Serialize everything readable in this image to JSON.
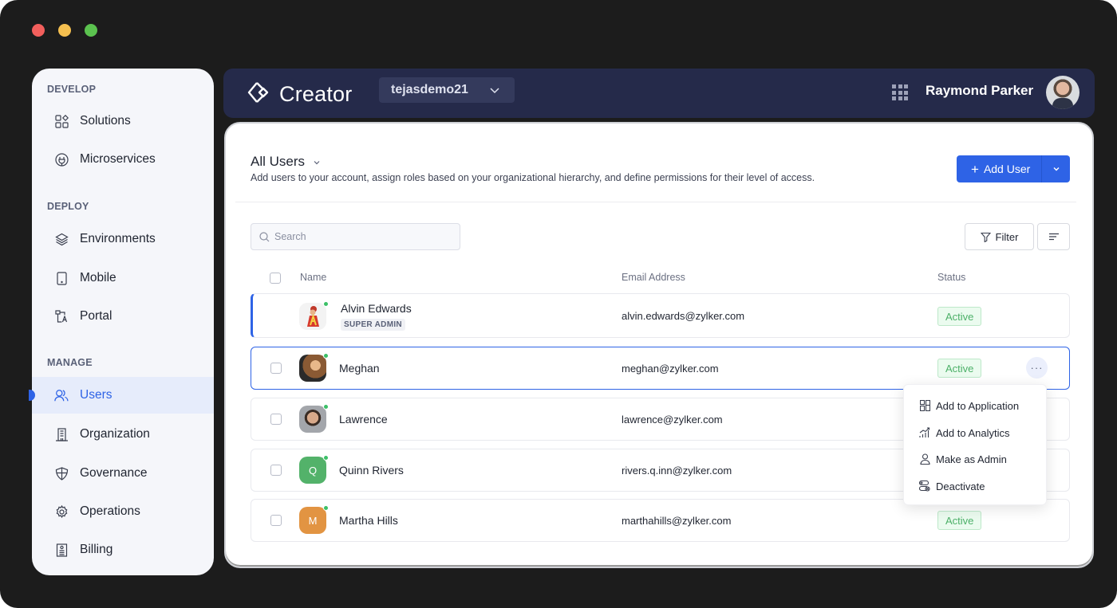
{
  "window": {
    "controls": [
      "close",
      "minimize",
      "maximize"
    ]
  },
  "sidebar": {
    "sections": [
      {
        "title": "DEVELOP",
        "items": [
          {
            "label": "Solutions",
            "icon": "solutions-icon"
          },
          {
            "label": "Microservices",
            "icon": "plug-icon"
          }
        ]
      },
      {
        "title": "DEPLOY",
        "items": [
          {
            "label": "Environments",
            "icon": "layers-icon"
          },
          {
            "label": "Mobile",
            "icon": "mobile-icon"
          },
          {
            "label": "Portal",
            "icon": "portal-icon"
          }
        ]
      },
      {
        "title": "MANAGE",
        "items": [
          {
            "label": "Users",
            "icon": "users-icon",
            "active": true
          },
          {
            "label": "Organization",
            "icon": "building-icon"
          },
          {
            "label": "Governance",
            "icon": "shield-icon"
          },
          {
            "label": "Operations",
            "icon": "gear-icon"
          },
          {
            "label": "Billing",
            "icon": "receipt-icon"
          }
        ]
      }
    ]
  },
  "header": {
    "app_name": "Creator",
    "workspace": "tejasdemo21",
    "user_name": "Raymond Parker",
    "accent": "#252a4a"
  },
  "main": {
    "title": "All Users",
    "description": "Add users to your account, assign roles based on your organizational hierarchy, and define permissions for their level of access.",
    "add_user_label": "Add User",
    "search_placeholder": "Search",
    "filter_label": "Filter",
    "columns": {
      "name": "Name",
      "email": "Email Address",
      "status": "Status"
    },
    "users": [
      {
        "name": "Alvin Edwards",
        "role": "SUPER ADMIN",
        "email": "alvin.edwards@zylker.com",
        "status": "Active",
        "initial": ""
      },
      {
        "name": "Meghan",
        "role": "",
        "email": "meghan@zylker.com",
        "status": "Active",
        "initial": ""
      },
      {
        "name": "Lawrence",
        "role": "",
        "email": "lawrence@zylker.com",
        "status": "",
        "initial": ""
      },
      {
        "name": "Quinn Rivers",
        "role": "",
        "email": "rivers.q.inn@zylker.com",
        "status": "",
        "initial": "Q"
      },
      {
        "name": "Martha Hills",
        "role": "",
        "email": "marthahills@zylker.com",
        "status": "Active",
        "initial": "M"
      }
    ],
    "context_menu": [
      {
        "label": "Add to Application",
        "icon": "application-icon"
      },
      {
        "label": "Add to Analytics",
        "icon": "analytics-icon"
      },
      {
        "label": "Make as Admin",
        "icon": "admin-icon"
      },
      {
        "label": "Deactivate",
        "icon": "deactivate-icon"
      }
    ],
    "colors": {
      "primary": "#2e63e6",
      "active_status": "#4cb068",
      "online": "#3cc068"
    }
  }
}
